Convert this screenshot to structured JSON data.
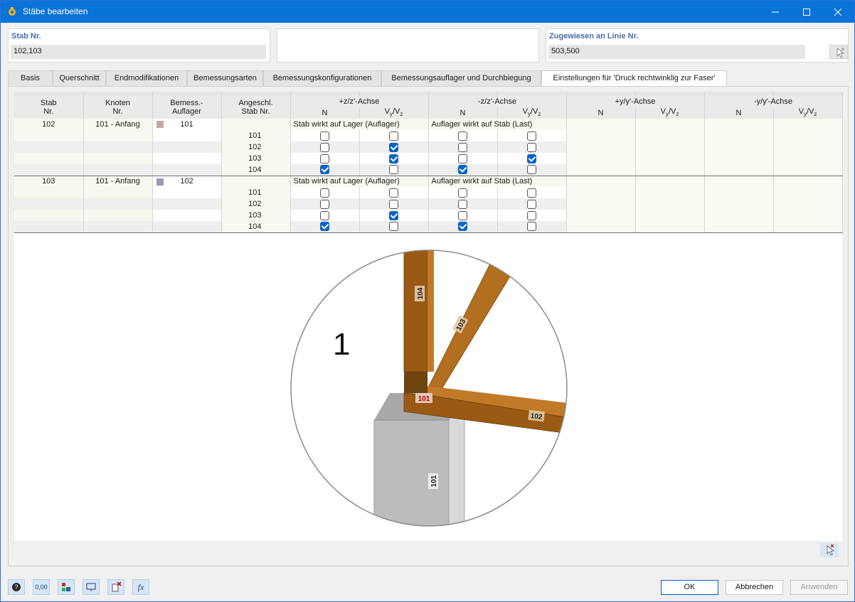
{
  "window": {
    "title": "Stäbe bearbeiten"
  },
  "header": {
    "stab": {
      "label": "Stab Nr.",
      "value": "102,103"
    },
    "linie": {
      "label": "Zugewiesen an Linie Nr.",
      "value": "503,500"
    }
  },
  "tabs": [
    {
      "label": "Basis"
    },
    {
      "label": "Querschnitt"
    },
    {
      "label": "Endmodifikationen"
    },
    {
      "label": "Bemessungsarten"
    },
    {
      "label": "Bemessungskonfigurationen"
    },
    {
      "label": "Bemessungsauflager und Durchbiegung"
    },
    {
      "label": "Einstellungen für 'Druck rechtwinklig zur Faser'"
    }
  ],
  "table": {
    "headers": {
      "stab": [
        "Stab",
        "Nr."
      ],
      "knoten": [
        "Knoten",
        "Nr."
      ],
      "bemess": [
        "Bemess.-",
        "Auflager"
      ],
      "angeschl": [
        "Angeschl.",
        "Stab Nr."
      ],
      "axes": [
        "+z/z'-Achse",
        "-z/z'-Achse",
        "+y/y'-Achse",
        "-y/y'-Achse"
      ],
      "n": "N",
      "v": "V",
      "v_sub1": "y",
      "v_sep": "/V",
      "v_sub2": "z"
    },
    "groups": [
      {
        "stab": "102",
        "knoten": "101 - Anfang",
        "auflager": "101",
        "swatch": "#c9a6a8",
        "pos_label": "Stab wirkt auf Lager (Auflager)",
        "neg_label": "Auflager wirkt auf Stab (Last)",
        "rows": [
          {
            "stab": "101",
            "zN": false,
            "zV": false,
            "nzN": false,
            "nzV": false
          },
          {
            "stab": "102",
            "zN": false,
            "zV": true,
            "nzN": false,
            "nzV": false
          },
          {
            "stab": "103",
            "zN": false,
            "zV": true,
            "nzN": false,
            "nzV": true
          },
          {
            "stab": "104",
            "zN": true,
            "zV": false,
            "nzN": true,
            "nzV": false
          }
        ]
      },
      {
        "stab": "103",
        "knoten": "101 - Anfang",
        "auflager": "102",
        "swatch": "#9c97b7",
        "pos_label": "Stab wirkt auf Lager (Auflager)",
        "neg_label": "Auflager wirkt auf Stab (Last)",
        "rows": [
          {
            "stab": "101",
            "zN": false,
            "zV": false,
            "nzN": false,
            "nzV": false
          },
          {
            "stab": "102",
            "zN": false,
            "zV": false,
            "nzN": false,
            "nzV": false
          },
          {
            "stab": "103",
            "zN": false,
            "zV": true,
            "nzN": false,
            "nzV": false
          },
          {
            "stab": "104",
            "zN": true,
            "zV": false,
            "nzN": true,
            "nzV": false
          }
        ]
      }
    ]
  },
  "figure": {
    "number": "1",
    "labels": {
      "m104": "104",
      "m103": "103",
      "m102": "102",
      "m101": "101",
      "node": "101"
    },
    "colors": {
      "timber": "#9a5a16",
      "timber_light": "#b8721f",
      "column": "#bfbfbf"
    }
  },
  "buttons": {
    "ok": "OK",
    "cancel": "Abbrechen",
    "apply": "Anwenden"
  },
  "toolbar": [
    {
      "icon": "help-icon"
    },
    {
      "icon": "units-icon",
      "text": "0,00"
    },
    {
      "icon": "objects-icon"
    },
    {
      "icon": "view-icon"
    },
    {
      "icon": "delete-selection-icon"
    },
    {
      "icon": "formula-icon",
      "text": "fx"
    }
  ]
}
